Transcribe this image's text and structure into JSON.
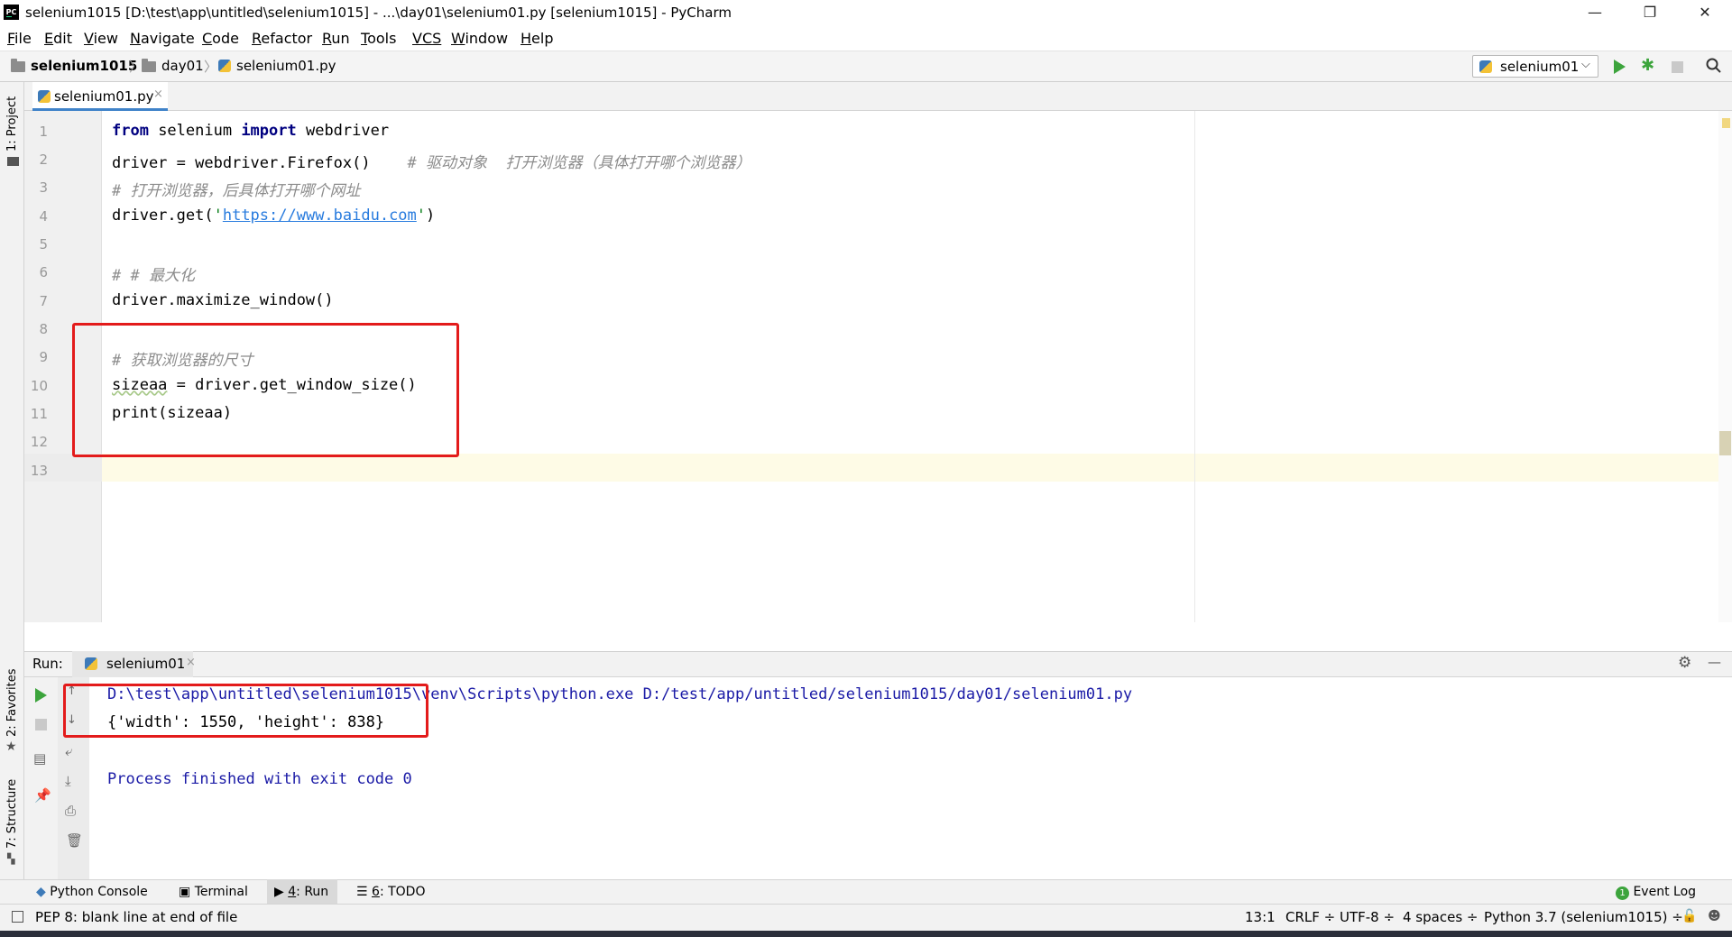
{
  "window": {
    "title": "selenium1015 [D:\\test\\app\\untitled\\selenium1015] - ...\\day01\\selenium01.py [selenium1015] - PyCharm",
    "app_icon_text": "PC",
    "minimize": "—",
    "restore": "❐",
    "close": "✕"
  },
  "menu": [
    {
      "u": "F",
      "rest": "ile"
    },
    {
      "u": "E",
      "rest": "dit"
    },
    {
      "u": "V",
      "rest": "iew"
    },
    {
      "u": "N",
      "rest": "avigate"
    },
    {
      "u": "C",
      "rest": "ode"
    },
    {
      "u": "R",
      "rest": "efactor"
    },
    {
      "u": "R",
      "rest": "un",
      "pre": ""
    },
    {
      "u": "T",
      "rest": "ools"
    },
    {
      "u": "VCS",
      "rest": ""
    },
    {
      "u": "W",
      "rest": "indow"
    },
    {
      "u": "H",
      "rest": "elp"
    }
  ],
  "breadcrumb": {
    "project": "selenium1015",
    "folder": "day01",
    "file": "selenium01.py"
  },
  "run_config": {
    "label": "selenium01",
    "chevron": "⌵"
  },
  "left_strip": {
    "project": "1: Project",
    "favorites": "2: Favorites",
    "structure": "7: Structure"
  },
  "editor_tab": {
    "label": "selenium01.py",
    "close": "×"
  },
  "line_numbers": [
    "1",
    "2",
    "3",
    "4",
    "5",
    "6",
    "7",
    "8",
    "9",
    "10",
    "11",
    "12",
    "13"
  ],
  "code": {
    "l1": {
      "kw1": "from",
      "t1": " selenium ",
      "kw2": "import",
      "t2": " webdriver"
    },
    "l2": {
      "t": "driver = webdriver.Firefox()    ",
      "cm": "# 驱动对象  打开浏览器（具体打开哪个浏览器）"
    },
    "l3": {
      "cm": "# 打开浏览器，后具体打开哪个网址"
    },
    "l4": {
      "t1": "driver.get(",
      "q1": "'",
      "url": "https://www.baidu.com",
      "q2": "'",
      "t2": ")"
    },
    "l6": {
      "cm": "# # 最大化"
    },
    "l7": {
      "t": "driver.maximize_window()"
    },
    "l9": {
      "cm": "# 获取浏览器的尺寸"
    },
    "l10": {
      "w": "sizeaa",
      "t": " = driver.get_window_size()"
    },
    "l11": {
      "t": "print(sizeaa)"
    }
  },
  "run_panel": {
    "label": "Run:",
    "tab": "selenium01",
    "tab_close": "×",
    "gear": "⚙",
    "hide": "—"
  },
  "console": {
    "cmd": "D:\\test\\app\\untitled\\selenium1015\\venv\\Scripts\\python.exe D:/test/app/untitled/selenium1015/day01/selenium01.py",
    "output": "{'width': 1550, 'height': 838}",
    "finished": "Process finished with exit code 0"
  },
  "bottom_tabs": {
    "python_console": "Python Console",
    "terminal": "Terminal",
    "run_u": "4",
    "run_rest": ": Run",
    "todo_u": "6",
    "todo_rest": ": TODO",
    "event_log": "Event Log",
    "event_count": "1"
  },
  "status": {
    "message": "PEP 8: blank line at end of file",
    "position": "13:1",
    "line_sep": "CRLF ÷",
    "encoding": "UTF-8 ÷",
    "indent": "4 spaces ÷",
    "interpreter": "Python 3.7 (selenium1015) ÷"
  },
  "colors": {
    "keyword": "#000080",
    "comment": "#8c8c8c",
    "url": "#287bde",
    "console_text": "#1a1aa6",
    "highlight_box": "#e31b1b",
    "caret_line": "#fefbe6",
    "run_green": "#3ca43c"
  }
}
